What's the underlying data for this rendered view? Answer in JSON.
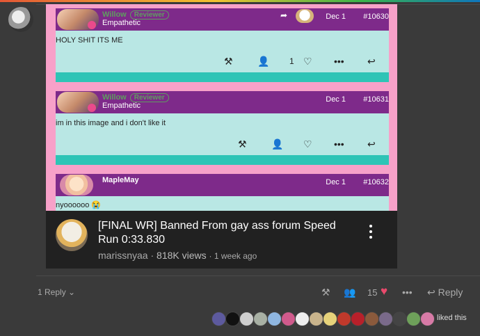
{
  "posts": [
    {
      "username": "Willow",
      "badge": "Reviewer",
      "user_title": "Empathetic",
      "date": "Dec 1",
      "number": "#10630",
      "text": "HOLY SHIT ITS ME",
      "like_count": "1"
    },
    {
      "username": "Willow",
      "badge": "Reviewer",
      "user_title": "Empathetic",
      "date": "Dec 1",
      "number": "#10631",
      "text": "im in this image and i don't like it"
    },
    {
      "username": "MapleMay",
      "date": "Dec 1",
      "number": "#10632",
      "text": "nyoooooo 😭"
    }
  ],
  "video": {
    "title": "[FINAL WR] Banned From gay ass forum Speed Run 0:33.830",
    "channel": "marissnyaa",
    "views": "818K views",
    "age": "1 week ago"
  },
  "controls": {
    "replies_label": "1 Reply",
    "like_count": "15",
    "reply_label": "Reply"
  },
  "liked_text": "liked this",
  "colors": {
    "accent_heart": "#e94a6c",
    "header_purple": "#7e2a8a",
    "body_cyan": "#b9e7e4",
    "bar_teal": "#2ec4b6",
    "frame_pink": "#f7a1c9"
  }
}
